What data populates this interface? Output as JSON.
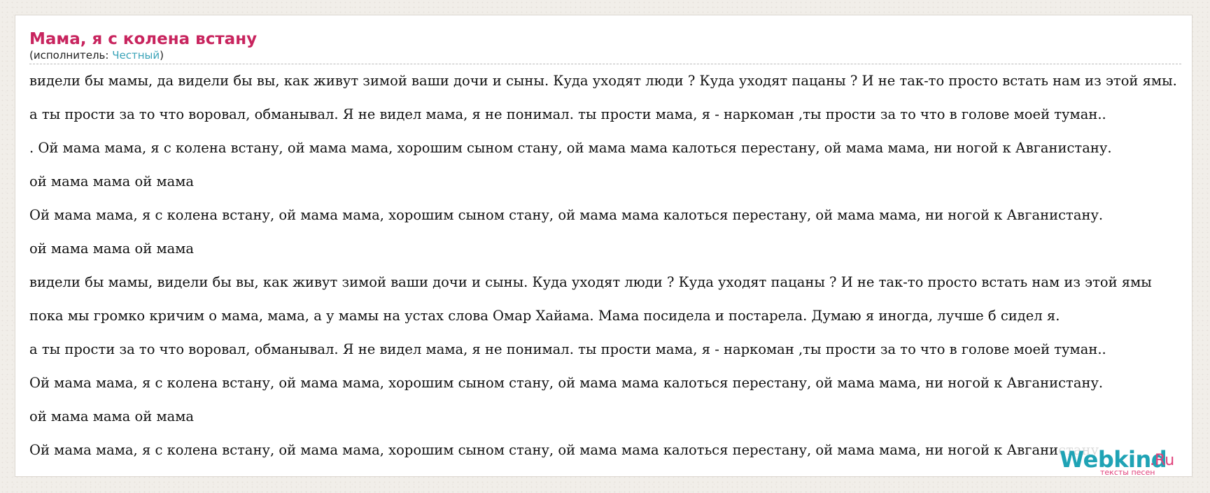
{
  "song": {
    "title": "Мама, я с колена встану",
    "artist_prefix": "(исполнитель: ",
    "artist_name": "Честный",
    "artist_suffix": ")"
  },
  "lyrics": [
    "видели бы мамы, да видели бы вы, как живут зимой ваши дочи и сыны. Куда уходят люди ? Куда уходят пацаны ? И не так-то просто встать нам из этой ямы.",
    "а ты прости за то что воровал, обманывал. Я не видел мама, я не понимал. ты прости мама, я - наркоман ,ты прости за то что в голове моей туман..",
    ". Ой мама мама, я с колена встану, ой мама мама, хорошим сыном стану, ой мама мама калоться перестану, ой мама мама, ни ногой к Авганистану.",
    "ой мама мама ой мама",
    "Ой мама мама, я с колена встану, ой мама мама, хорошим сыном стану, ой мама мама калоться перестану, ой мама мама, ни ногой к Авганистану.",
    "ой мама мама ой мама",
    "видели бы мамы, видели бы вы, как живут зимой ваши дочи и сыны. Куда уходят люди ? Куда уходят пацаны ? И не так-то просто встать нам из этой ямы",
    "пока мы громко кричим о мама, мама, а у мамы на устах слова Омар Хайама. Мама посидела и постарела. Думаю я иногда, лучше б сидел я.",
    "а ты прости за то что воровал, обманывал. Я не видел мама, я не понимал. ты прости мама, я - наркоман ,ты прости за то что в голове моей туман..",
    "Ой мама мама, я с колена встану, ой мама мама, хорошим сыном стану, ой мама мама калоться перестану, ой мама мама, ни ногой к Авганистану.",
    "ой мама мама ой мама",
    "Ой мама мама, я с колена встану, ой мама мама, хорошим сыном стану, ой мама мама калоться перестану, ой мама мама, ни ногой к Авганистану."
  ],
  "logo": {
    "main": "Webkind",
    "tld": ".Ru",
    "tagline": "тексты песен"
  },
  "colors": {
    "title": "#c8245e",
    "artist_link": "#3aa3b8",
    "logo_main": "#1fa3b5",
    "logo_accent": "#e0407a"
  }
}
